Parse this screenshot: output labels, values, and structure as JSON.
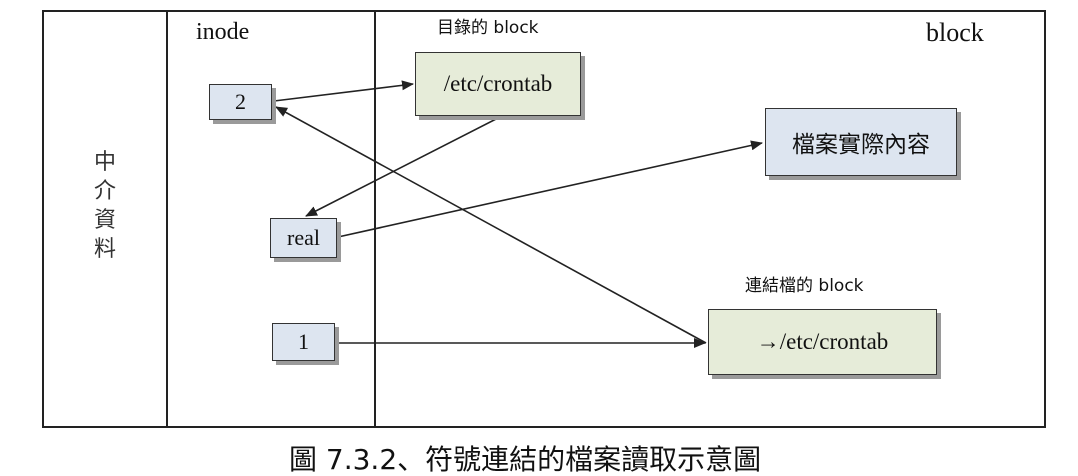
{
  "left_column": {
    "vertical_label": [
      "中",
      "介",
      "資",
      "料"
    ]
  },
  "headers": {
    "inode": "inode",
    "block": "block",
    "dir_block": "目錄的 block",
    "link_block": "連結檔的 block"
  },
  "inode_boxes": {
    "two": "2",
    "real": "real",
    "one": "1"
  },
  "block_boxes": {
    "dir_entry": "/etc/crontab",
    "content": "檔案實際內容",
    "link_target": "→/etc/crontab"
  },
  "caption": "圖 7.3.2、符號連結的檔案讀取示意圖",
  "colors": {
    "inode_fill": "#dde5f0",
    "block_green_fill": "#e6ecd9",
    "line": "#222222"
  }
}
